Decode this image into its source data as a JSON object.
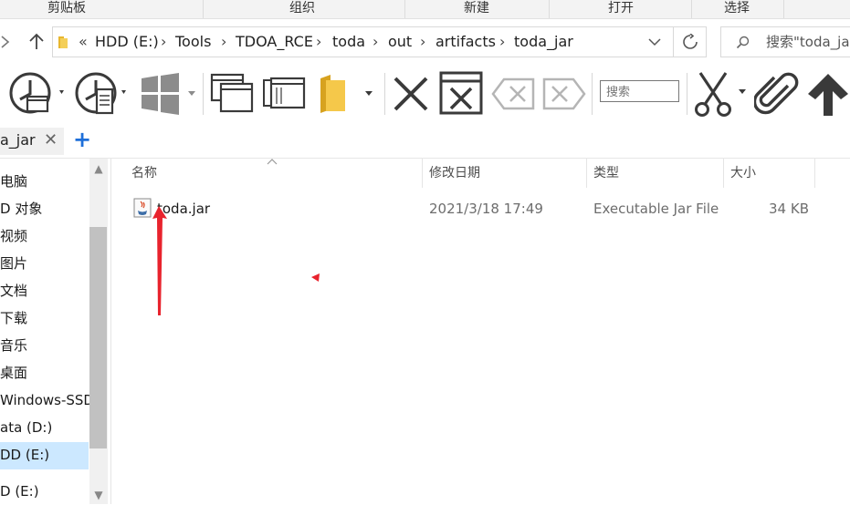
{
  "ribbon": {
    "groups": [
      "剪贴板",
      "组织",
      "新建",
      "打开",
      "选择"
    ]
  },
  "address": {
    "overflow": "«",
    "breadcrumbs": [
      "HDD (E:)",
      "Tools",
      "TDOA_RCE",
      "toda",
      "out",
      "artifacts",
      "toda_jar"
    ],
    "search_text": "搜索\"toda_jar\""
  },
  "toolbar": {
    "search_placeholder": "搜索",
    "icons": [
      "history-icon",
      "history-folder-icon",
      "windows-icon",
      "window-panes-icon",
      "window-list-icon",
      "folder-icon",
      "close-x-icon",
      "window-close-icon",
      "backspace-icon",
      "backspace-icon",
      "scissors-icon",
      "paperclip-icon",
      "arrow-up-icon"
    ]
  },
  "tabs": [
    {
      "label": "a_jar",
      "active": true
    }
  ],
  "nav": {
    "items": [
      "电脑",
      "D 对象",
      "视频",
      "图片",
      "文档",
      "下载",
      "音乐",
      "桌面",
      "Windows-SSD (",
      "ata (D:)",
      "DD (E:)",
      "D (E:)"
    ],
    "selected_index": 10
  },
  "file_list": {
    "columns": [
      "名称",
      "修改日期",
      "类型",
      "大小"
    ],
    "rows": [
      {
        "name": "toda.jar",
        "modified": "2021/3/18 17:49",
        "type": "Executable Jar File",
        "size": "34 KB"
      }
    ]
  },
  "colors": {
    "selection": "#cce8ff",
    "accent": "#1e6fd9",
    "annotation": "#e8232d"
  }
}
